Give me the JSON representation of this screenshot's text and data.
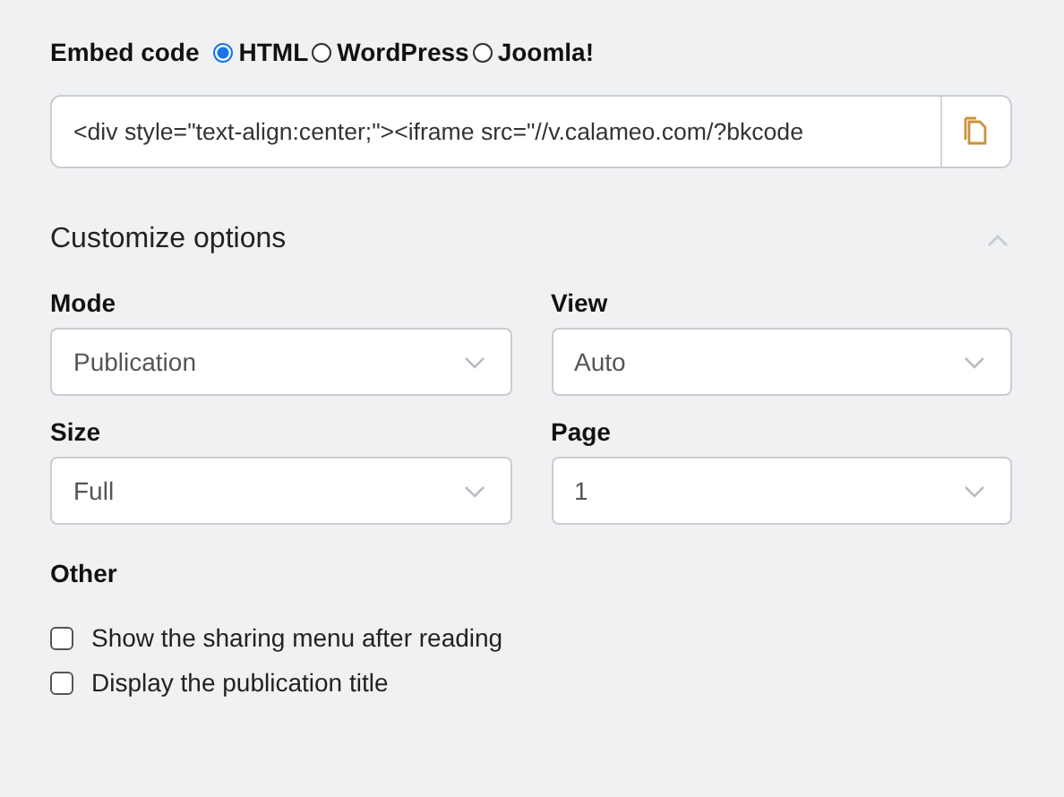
{
  "embed": {
    "label": "Embed code",
    "formats": [
      {
        "label": "HTML",
        "selected": true
      },
      {
        "label": "WordPress",
        "selected": false
      },
      {
        "label": "Joomla!",
        "selected": false
      }
    ],
    "code": "<div style=\"text-align:center;\"><iframe src=\"//v.calameo.com/?bkcode"
  },
  "customize": {
    "title": "Customize options",
    "expanded": true,
    "selects": [
      {
        "label": "Mode",
        "value": "Publication"
      },
      {
        "label": "View",
        "value": "Auto"
      },
      {
        "label": "Size",
        "value": "Full"
      },
      {
        "label": "Page",
        "value": "1"
      }
    ],
    "other": {
      "label": "Other",
      "options": [
        {
          "label": "Show the sharing menu after reading",
          "checked": false
        },
        {
          "label": "Display the publication title",
          "checked": false
        }
      ]
    }
  }
}
